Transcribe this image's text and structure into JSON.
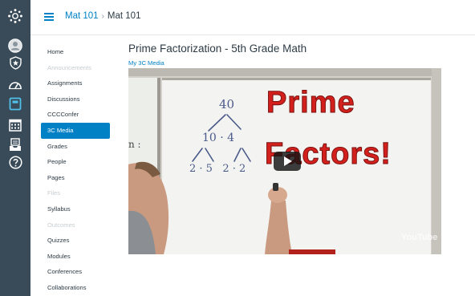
{
  "nav_rail": {
    "icons": [
      "canvas-logo-icon",
      "account-avatar-icon",
      "admin-shield-icon",
      "dashboard-icon",
      "courses-icon",
      "calendar-icon",
      "inbox-icon",
      "help-icon"
    ],
    "bg_color": "#394b58"
  },
  "header": {
    "crumb_course": "Mat 101",
    "crumb_current": "Mat 101",
    "separator": "›"
  },
  "course_nav": {
    "items": [
      {
        "label": "Home",
        "state": "normal"
      },
      {
        "label": "Announcements",
        "state": "disabled"
      },
      {
        "label": "Assignments",
        "state": "normal"
      },
      {
        "label": "Discussions",
        "state": "normal"
      },
      {
        "label": "CCCConfer",
        "state": "normal"
      },
      {
        "label": "3C Media",
        "state": "active"
      },
      {
        "label": "Grades",
        "state": "normal"
      },
      {
        "label": "People",
        "state": "normal"
      },
      {
        "label": "Pages",
        "state": "normal"
      },
      {
        "label": "Files",
        "state": "disabled"
      },
      {
        "label": "Syllabus",
        "state": "normal"
      },
      {
        "label": "Outcomes",
        "state": "disabled"
      },
      {
        "label": "Quizzes",
        "state": "normal"
      },
      {
        "label": "Modules",
        "state": "normal"
      },
      {
        "label": "Conferences",
        "state": "normal"
      },
      {
        "label": "Collaborations",
        "state": "normal"
      }
    ],
    "active_color": "#0081c6"
  },
  "main": {
    "title": "Prime Factorization - 5th Grade Math",
    "media_link": "My 3C Media"
  },
  "video": {
    "overlay_line1": "Prime",
    "overlay_line2": "Factors!",
    "board_top": "40",
    "board_mid": "10 · 4",
    "board_bottom": "2 · 5   2 · 2",
    "board_left": "n :",
    "watermark": "YouTube",
    "overlay_color": "#d3201d"
  }
}
